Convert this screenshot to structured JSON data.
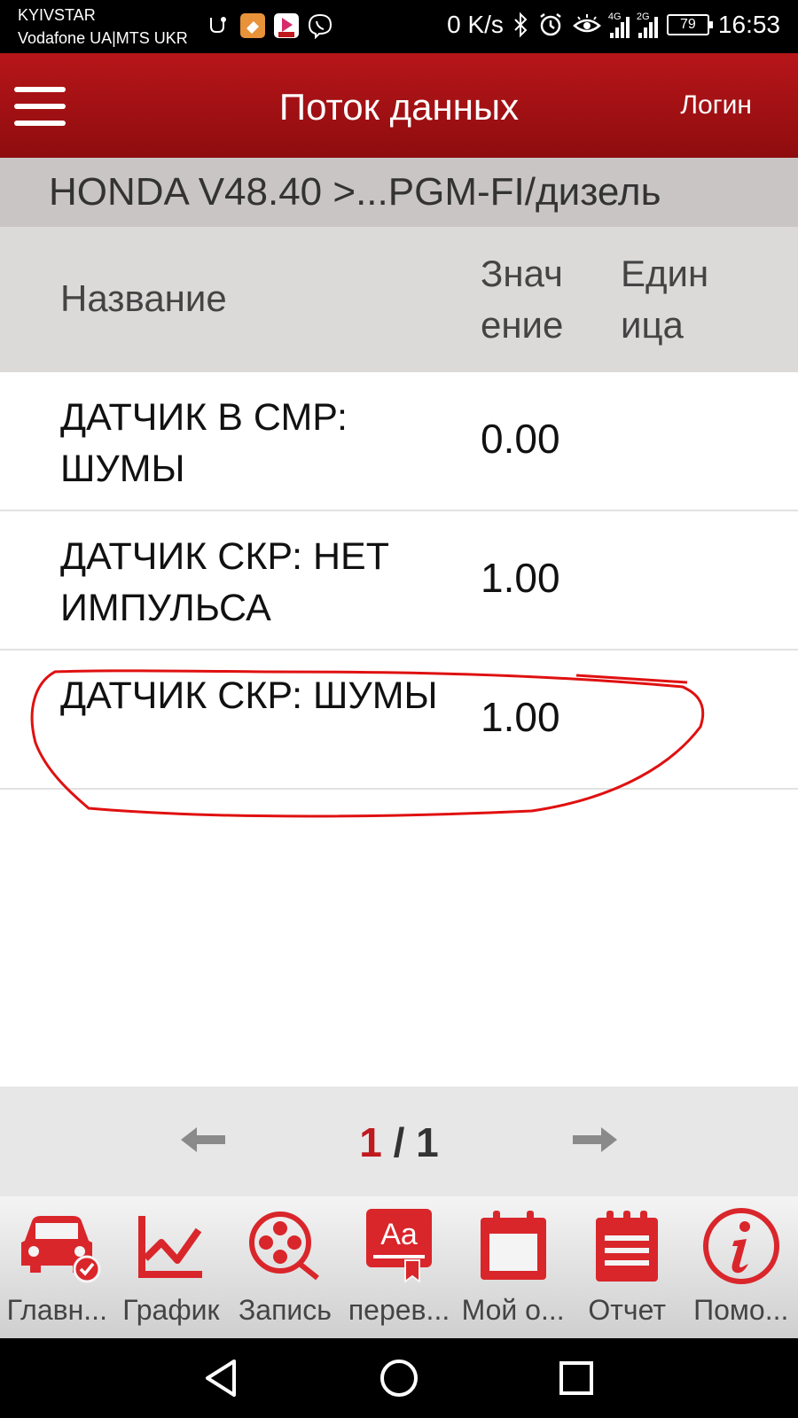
{
  "status_bar": {
    "carrier1": "KYIVSTAR",
    "carrier2": "Vodafone UA|MTS UKR",
    "net_speed": "0 K/s",
    "net1": "4G",
    "net2": "2G",
    "battery": "79",
    "time": "16:53"
  },
  "header": {
    "title": "Поток данных",
    "login_label": "Логин"
  },
  "breadcrumb": "HONDA V48.40 >...PGM-FI/дизель",
  "table": {
    "columns": {
      "name": "Название",
      "value": "Значение",
      "value_lines": [
        "Знач",
        "ение"
      ],
      "unit": "Единица",
      "unit_lines": [
        "Един",
        "ица"
      ]
    },
    "rows": [
      {
        "name": "ДАТЧИК В СМР: ШУМЫ",
        "value": "0.00",
        "unit": ""
      },
      {
        "name": "ДАТЧИК СКР: НЕТ ИМПУЛЬСА",
        "value": "1.00",
        "unit": ""
      },
      {
        "name": "ДАТЧИК СКР: ШУМЫ",
        "value": "1.00",
        "unit": ""
      }
    ]
  },
  "pagination": {
    "current": "1",
    "separator": " / ",
    "total": "1"
  },
  "toolbar": {
    "items": [
      {
        "label": "Главн...",
        "icon": "car-check-icon"
      },
      {
        "label": "График",
        "icon": "chart-line-icon"
      },
      {
        "label": "Запись",
        "icon": "film-reel-icon"
      },
      {
        "label": "перев...",
        "icon": "translate-icon"
      },
      {
        "label": "Мой о...",
        "icon": "calendar-icon"
      },
      {
        "label": "Отчет",
        "icon": "report-icon"
      },
      {
        "label": "Помо...",
        "icon": "info-icon"
      }
    ]
  },
  "colors": {
    "accent": "#c0191e",
    "header_bg": "#a31215",
    "breadcrumb_bg": "#c9c5c5",
    "column_header_bg": "#dcd9d9",
    "annotation": "#e01010"
  }
}
